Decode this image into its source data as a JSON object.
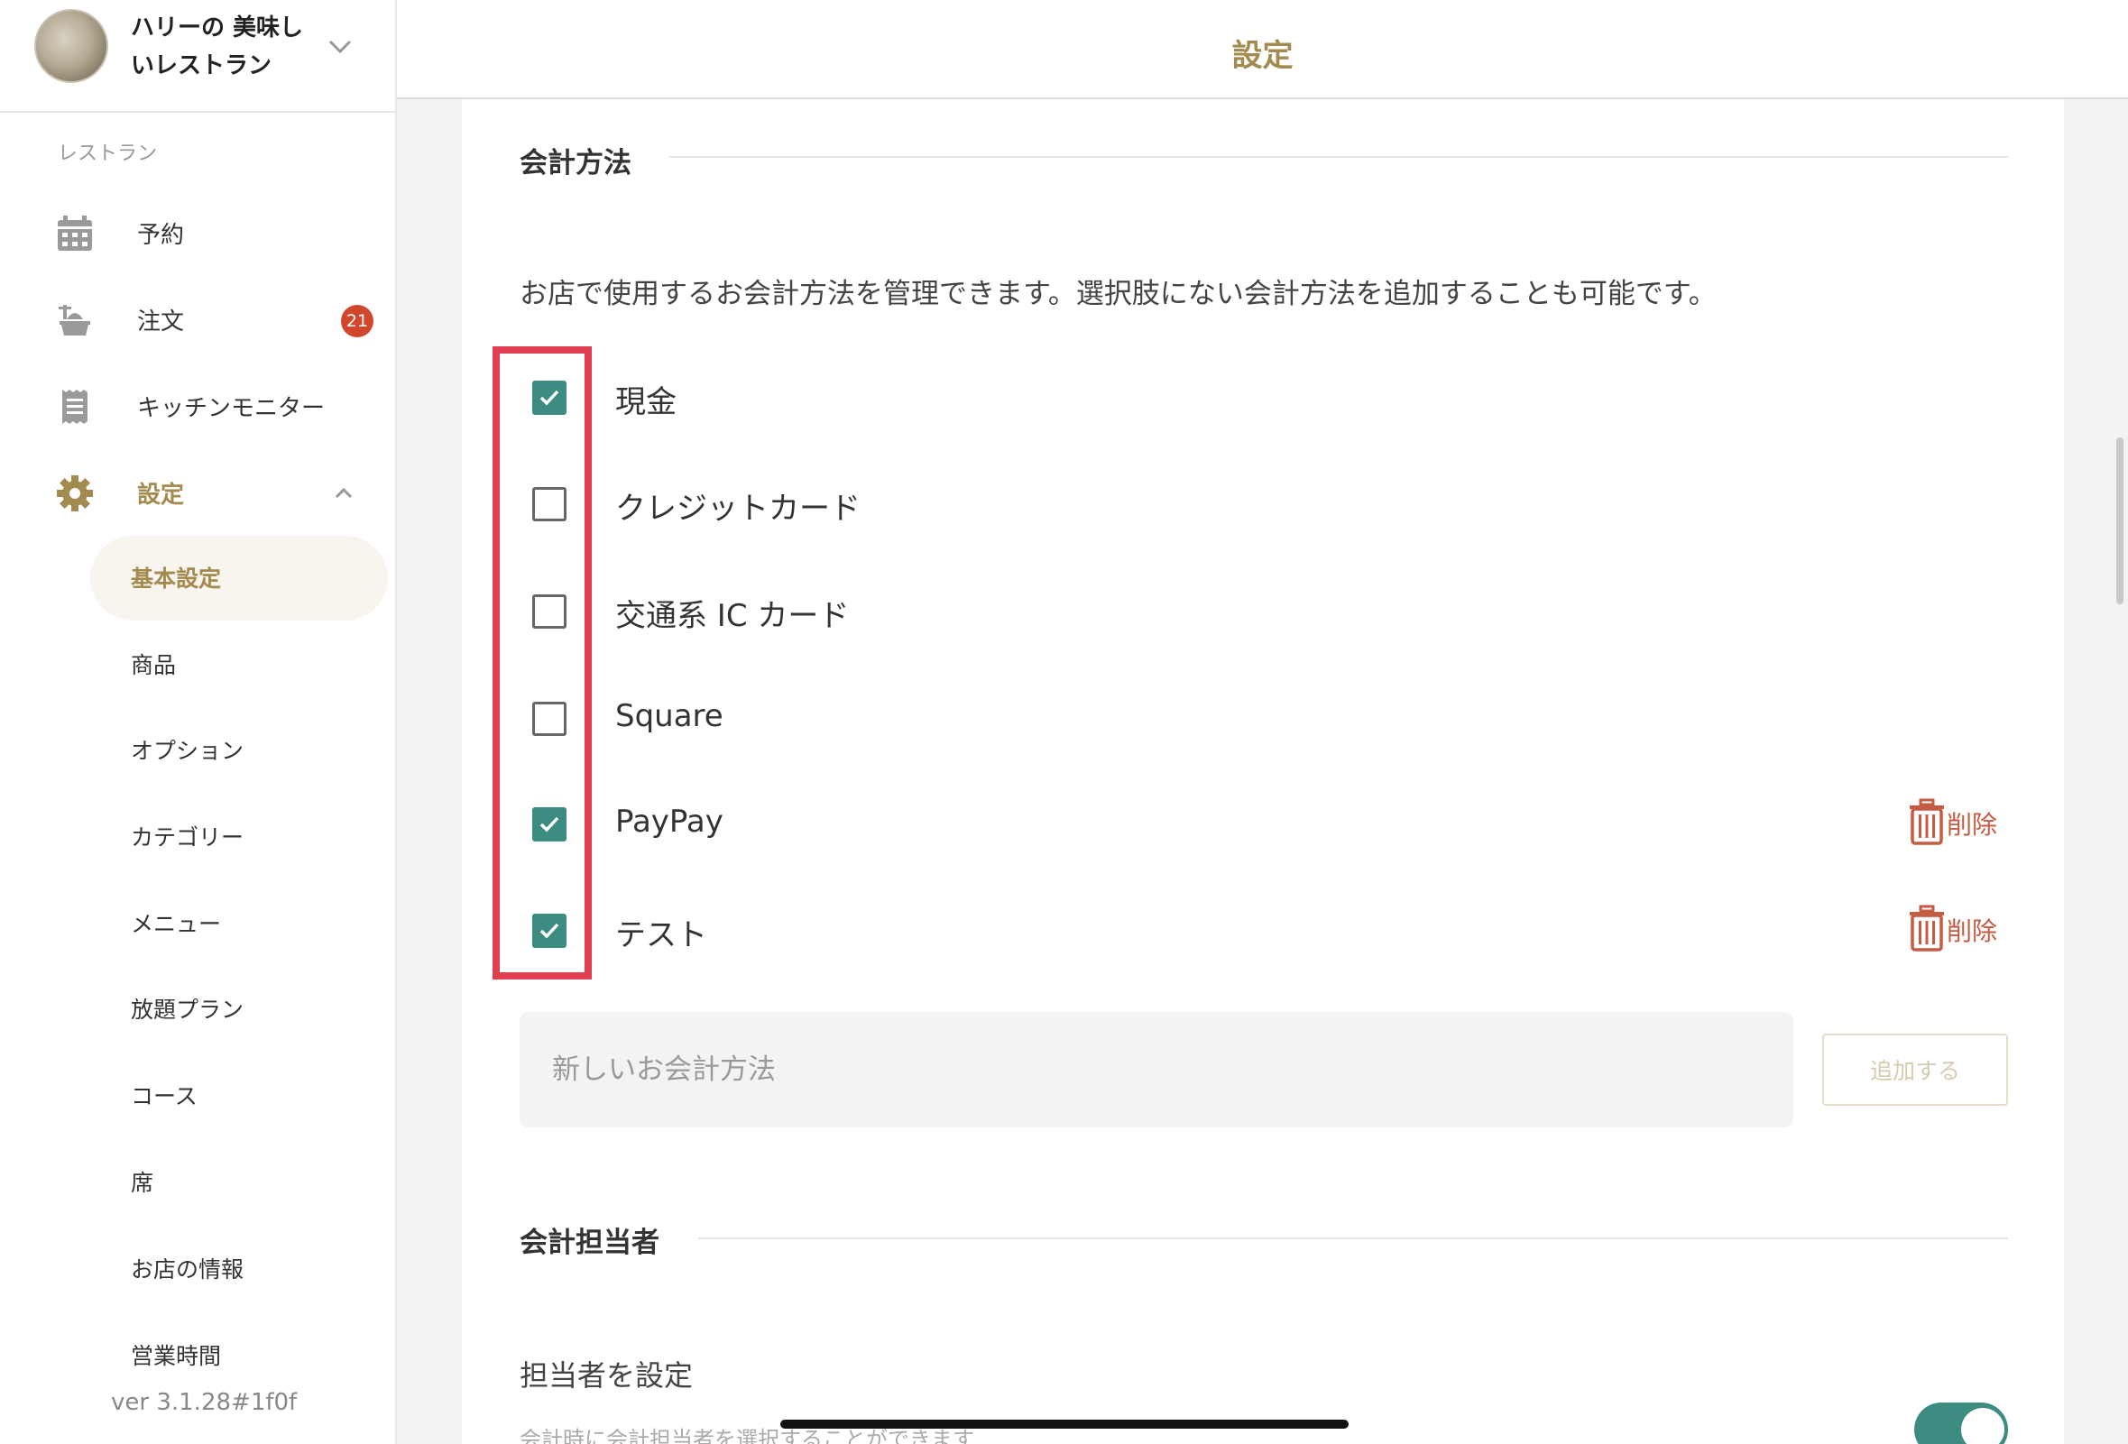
{
  "store": {
    "name": "ハリーの 美味しいレストラン"
  },
  "sidebar": {
    "section_label": "レストラン",
    "nav": [
      {
        "label": "予約",
        "icon": "calendar-icon"
      },
      {
        "label": "注文",
        "icon": "order-icon",
        "badge": "21"
      },
      {
        "label": "キッチンモニター",
        "icon": "receipt-icon"
      },
      {
        "label": "設定",
        "icon": "gear-icon"
      }
    ],
    "sub_items": [
      {
        "label": "基本設定"
      },
      {
        "label": "商品"
      },
      {
        "label": "オプション"
      },
      {
        "label": "カテゴリー"
      },
      {
        "label": "メニュー"
      },
      {
        "label": "放題プラン"
      },
      {
        "label": "コース"
      },
      {
        "label": "席"
      },
      {
        "label": "お店の情報"
      },
      {
        "label": "営業時間"
      }
    ],
    "version": "ver 3.1.28#1f0f"
  },
  "topbar": {
    "title": "設定"
  },
  "payment": {
    "heading": "会計方法",
    "description": "お店で使用するお会計方法を管理できます。選択肢にない会計方法を追加することも可能です。",
    "options": [
      {
        "label": "現金",
        "checked": true
      },
      {
        "label": "クレジットカード",
        "checked": false
      },
      {
        "label": "交通系 IC カード",
        "checked": false
      },
      {
        "label": "Square",
        "checked": false
      },
      {
        "label": "PayPay",
        "checked": true,
        "delete_label": "削除"
      },
      {
        "label": "テスト",
        "checked": true,
        "delete_label": "削除"
      }
    ],
    "new_placeholder": "新しいお会計方法",
    "add_button": "追加する"
  },
  "cashier": {
    "heading": "会計担当者",
    "setting_label": "担当者を設定",
    "setting_desc": "会計時に会計担当者を選択することができます",
    "enabled": true
  },
  "colors": {
    "accent": "#a38a4f",
    "check": "#3d8c81",
    "highlight": "#e0404f",
    "delete": "#c65b43",
    "badge": "#d2462e"
  }
}
